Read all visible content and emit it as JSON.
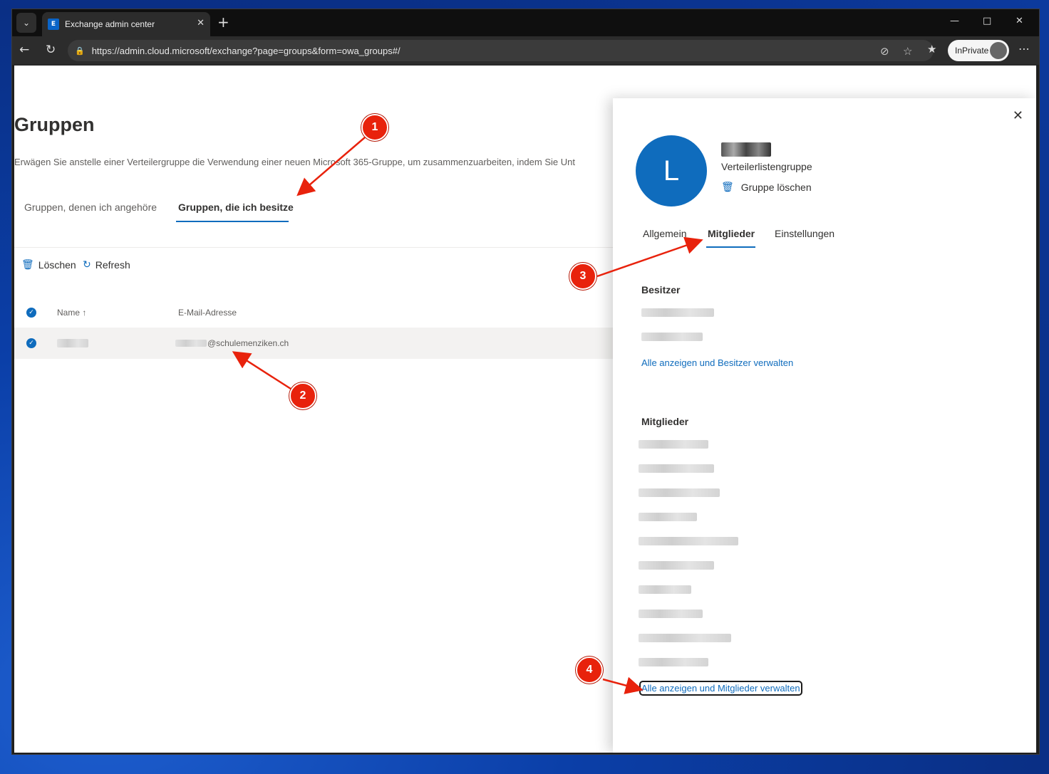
{
  "browser": {
    "tab_title": "Exchange admin center",
    "url": "https://admin.cloud.microsoft/exchange?page=groups&form=owa_groups#/",
    "inprivate_label": "InPrivate"
  },
  "page": {
    "title": "Gruppen",
    "description": "Erwägen Sie anstelle einer Verteilergruppe die Verwendung einer neuen Microsoft 365-Gruppe, um zusammenzuarbeiten, indem Sie Unt",
    "tabs": [
      {
        "label": "Gruppen, denen ich angehöre"
      },
      {
        "label": "Gruppen, die ich besitze"
      }
    ],
    "commands": {
      "delete_label": "Löschen",
      "refresh_label": "Refresh"
    },
    "columns": {
      "name": "Name",
      "sort_glyph": "↑",
      "email": "E-Mail-Adresse"
    },
    "rows": [
      {
        "email_suffix": "@schulemenziken.ch"
      }
    ]
  },
  "panel": {
    "avatar_letter": "L",
    "group_type": "Verteilerlistengruppe",
    "delete_group_label": "Gruppe löschen",
    "tabs": [
      {
        "label": "Allgemein"
      },
      {
        "label": "Mitglieder"
      },
      {
        "label": "Einstellungen"
      }
    ],
    "owners_heading": "Besitzer",
    "owners_link": "Alle anzeigen und Besitzer verwalten",
    "members_heading": "Mitglieder",
    "members_link": "Alle anzeigen und Mitglieder verwalten"
  },
  "annotations": {
    "badges": [
      "1",
      "2",
      "3",
      "4"
    ],
    "color": "#e8220c"
  }
}
